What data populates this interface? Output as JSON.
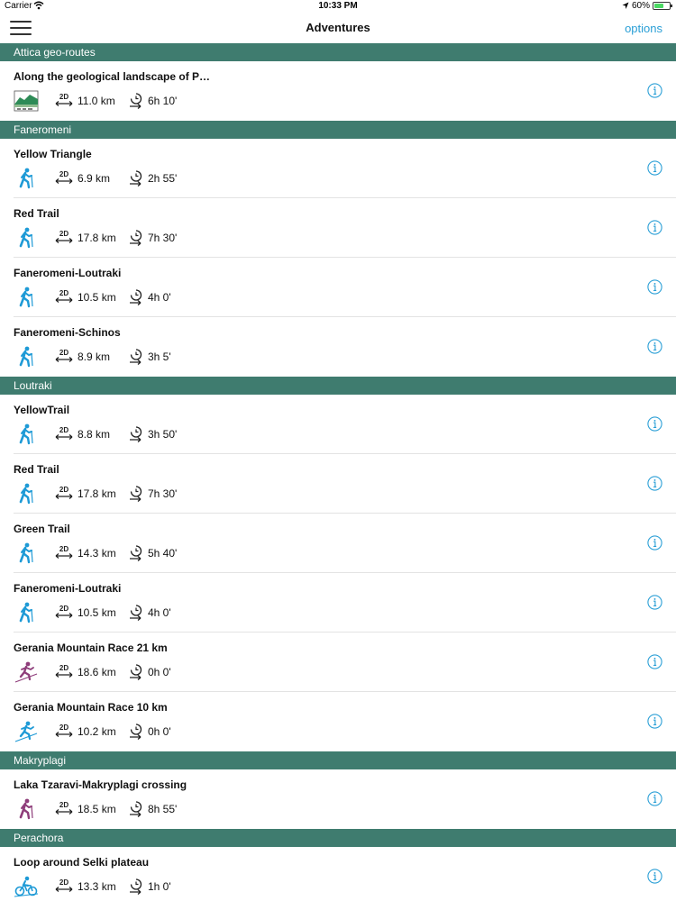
{
  "status": {
    "carrier": "Carrier",
    "time": "10:33 PM",
    "battery": "60%"
  },
  "nav": {
    "title": "Adventures",
    "options": "options"
  },
  "sections": [
    {
      "title": "Attica geo-routes",
      "routes": [
        {
          "name": "Along the geological landscape of P…",
          "distance": "11.0 km",
          "duration": "6h 10'",
          "activity": "geo-landscape-icon"
        }
      ]
    },
    {
      "title": "Faneromeni",
      "routes": [
        {
          "name": "Yellow Triangle",
          "distance": "6.9 km",
          "duration": "2h 55'",
          "activity": "hiker-icon"
        },
        {
          "name": "Red Trail",
          "distance": "17.8 km",
          "duration": "7h 30'",
          "activity": "hiker-icon"
        },
        {
          "name": "Faneromeni-Loutraki",
          "distance": "10.5 km",
          "duration": "4h 0'",
          "activity": "hiker-icon"
        },
        {
          "name": "Faneromeni-Schinos",
          "distance": "8.9 km",
          "duration": "3h 5'",
          "activity": "hiker-icon"
        }
      ]
    },
    {
      "title": "Loutraki",
      "routes": [
        {
          "name": "YellowTrail",
          "distance": "8.8 km",
          "duration": "3h 50'",
          "activity": "hiker-icon"
        },
        {
          "name": "Red Trail",
          "distance": "17.8 km",
          "duration": "7h 30'",
          "activity": "hiker-icon"
        },
        {
          "name": "Green Trail",
          "distance": "14.3 km",
          "duration": "5h 40'",
          "activity": "hiker-icon"
        },
        {
          "name": "Faneromeni-Loutraki",
          "distance": "10.5 km",
          "duration": "4h 0'",
          "activity": "hiker-icon"
        },
        {
          "name": "Gerania Mountain Race 21 km",
          "distance": "18.6 km",
          "duration": "0h 0'",
          "activity": "trail-runner-purple-icon"
        },
        {
          "name": "Gerania Mountain Race 10 km",
          "distance": "10.2 km",
          "duration": "0h 0'",
          "activity": "trail-runner-blue-icon"
        }
      ]
    },
    {
      "title": "Makryplagi",
      "routes": [
        {
          "name": "Laka Tzaravi-Makryplagi crossing",
          "distance": "18.5 km",
          "duration": "8h 55'",
          "activity": "hiker-purple-icon"
        }
      ]
    },
    {
      "title": "Perachora",
      "routes": [
        {
          "name": "Loop around Selki plateau",
          "distance": "13.3 km",
          "duration": "1h 0'",
          "activity": "mountain-bike-icon"
        }
      ]
    }
  ],
  "colors": {
    "section_header": "#3f7c6f",
    "accent": "#2a9fd6",
    "hiker_blue": "#1e9ad6",
    "purple": "#8e3d7a"
  }
}
